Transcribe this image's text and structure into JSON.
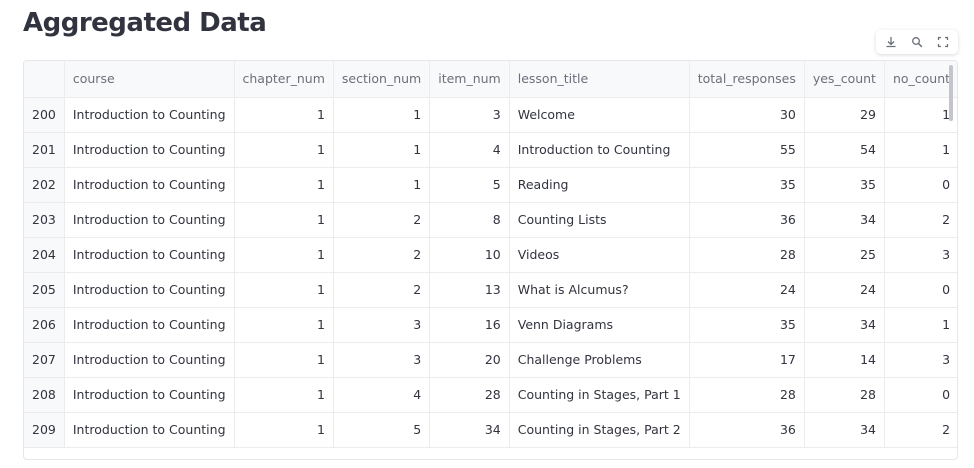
{
  "page": {
    "title": "Aggregated Data"
  },
  "toolbar": {
    "download_icon": "download-icon",
    "search_icon": "search-icon",
    "fullscreen_icon": "fullscreen-icon"
  },
  "table": {
    "columns": [
      {
        "key": "course",
        "label": "course",
        "align": "left"
      },
      {
        "key": "chapter_num",
        "label": "chapter_num",
        "align": "right"
      },
      {
        "key": "section_num",
        "label": "section_num",
        "align": "right"
      },
      {
        "key": "item_num",
        "label": "item_num",
        "align": "right"
      },
      {
        "key": "lesson_title",
        "label": "lesson_title",
        "align": "left"
      },
      {
        "key": "total_responses",
        "label": "total_responses",
        "align": "right"
      },
      {
        "key": "yes_count",
        "label": "yes_count",
        "align": "right"
      },
      {
        "key": "no_count",
        "label": "no_count",
        "align": "right"
      }
    ],
    "rows": [
      {
        "index": "200",
        "course": "Introduction to Counting",
        "chapter_num": "1",
        "section_num": "1",
        "item_num": "3",
        "lesson_title": "Welcome",
        "total_responses": "30",
        "yes_count": "29",
        "no_count": "1"
      },
      {
        "index": "201",
        "course": "Introduction to Counting",
        "chapter_num": "1",
        "section_num": "1",
        "item_num": "4",
        "lesson_title": "Introduction to Counting",
        "total_responses": "55",
        "yes_count": "54",
        "no_count": "1"
      },
      {
        "index": "202",
        "course": "Introduction to Counting",
        "chapter_num": "1",
        "section_num": "1",
        "item_num": "5",
        "lesson_title": "Reading",
        "total_responses": "35",
        "yes_count": "35",
        "no_count": "0"
      },
      {
        "index": "203",
        "course": "Introduction to Counting",
        "chapter_num": "1",
        "section_num": "2",
        "item_num": "8",
        "lesson_title": "Counting Lists",
        "total_responses": "36",
        "yes_count": "34",
        "no_count": "2"
      },
      {
        "index": "204",
        "course": "Introduction to Counting",
        "chapter_num": "1",
        "section_num": "2",
        "item_num": "10",
        "lesson_title": "Videos",
        "total_responses": "28",
        "yes_count": "25",
        "no_count": "3"
      },
      {
        "index": "205",
        "course": "Introduction to Counting",
        "chapter_num": "1",
        "section_num": "2",
        "item_num": "13",
        "lesson_title": "What is Alcumus?",
        "total_responses": "24",
        "yes_count": "24",
        "no_count": "0"
      },
      {
        "index": "206",
        "course": "Introduction to Counting",
        "chapter_num": "1",
        "section_num": "3",
        "item_num": "16",
        "lesson_title": "Venn Diagrams",
        "total_responses": "35",
        "yes_count": "34",
        "no_count": "1"
      },
      {
        "index": "207",
        "course": "Introduction to Counting",
        "chapter_num": "1",
        "section_num": "3",
        "item_num": "20",
        "lesson_title": "Challenge Problems",
        "total_responses": "17",
        "yes_count": "14",
        "no_count": "3"
      },
      {
        "index": "208",
        "course": "Introduction to Counting",
        "chapter_num": "1",
        "section_num": "4",
        "item_num": "28",
        "lesson_title": "Counting in Stages, Part 1",
        "total_responses": "28",
        "yes_count": "28",
        "no_count": "0"
      },
      {
        "index": "209",
        "course": "Introduction to Counting",
        "chapter_num": "1",
        "section_num": "5",
        "item_num": "34",
        "lesson_title": "Counting in Stages, Part 2",
        "total_responses": "36",
        "yes_count": "34",
        "no_count": "2"
      }
    ]
  }
}
